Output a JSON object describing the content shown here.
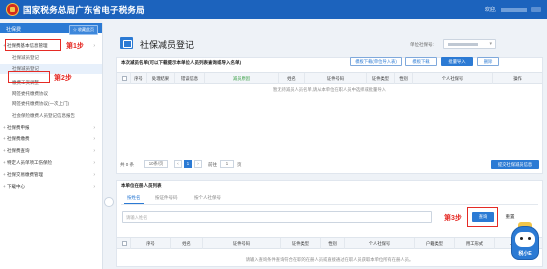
{
  "header": {
    "title": "国家税务总局广东省电子税务局",
    "welcome": "欢迎,"
  },
  "sidebar": {
    "head_label": "社保费",
    "fav_label": "☆ 收藏此页",
    "items": [
      {
        "label": "社保费基本信息管理",
        "type": "group"
      },
      {
        "label": "社保减员登记",
        "type": "sub"
      },
      {
        "label": "社保减员登记",
        "type": "sub",
        "selected": true
      },
      {
        "label": "缴费工资调整",
        "type": "sub"
      },
      {
        "label": "网签委托缴费协议",
        "type": "sub"
      },
      {
        "label": "网签委托缴费协议(一次上门)",
        "type": "sub"
      },
      {
        "label": "社会保险缴费人员登记信息报告",
        "type": "sub"
      },
      {
        "label": "社保费申报",
        "type": "group"
      },
      {
        "label": "社保费缴费",
        "type": "group"
      },
      {
        "label": "社保费查询",
        "type": "group"
      },
      {
        "label": "特定人员单项工伤保险",
        "type": "group"
      },
      {
        "label": "社保交易缴费管理",
        "type": "group"
      },
      {
        "label": "下载中心",
        "type": "group"
      }
    ]
  },
  "steps": {
    "step1": "第1步",
    "step2": "第2步",
    "step3": "第3步"
  },
  "page": {
    "title": "社保减员登记",
    "taxpayer_label": "单位社保号:"
  },
  "upper": {
    "section_title": "本次减员名单(可以下载提示本单位人员列表查询或导入名单)",
    "actions": [
      "模板下载(单位导入表)",
      "模板下载",
      "批量导入",
      "删除"
    ],
    "columns": [
      "序号",
      "处理结果",
      "错误信息",
      "减员原因",
      "姓名",
      "证件号码",
      "证件类型",
      "性别",
      "个人社保号",
      "操作"
    ],
    "no_data": "暂无待减员人员名单,请从本单位在职人员中选择或批量导入",
    "pager": {
      "total": "共 0 条",
      "per_page": "10条/页",
      "page": "1",
      "goto_label": "前往",
      "goto_value": "1",
      "goto_unit": "页"
    },
    "submit_button": "提交社保减员信息"
  },
  "lower": {
    "section_title": "本单位在册人员列表",
    "tabs": [
      "按姓名",
      "按证件号码",
      "按个人社保号"
    ],
    "search_placeholder": "请输入姓名",
    "search_button": "查询",
    "reset_button": "重置",
    "columns": [
      "序号",
      "姓名",
      "证件号码",
      "证件类型",
      "性别",
      "个人社保号",
      "户籍类型",
      "用工形式",
      "人员身份"
    ],
    "no_data": "请输入查询条件查询符合在职的在册人员或直接通过在职人员获取本单位所有在册人员。"
  },
  "mascot": {
    "text": "税小E"
  }
}
